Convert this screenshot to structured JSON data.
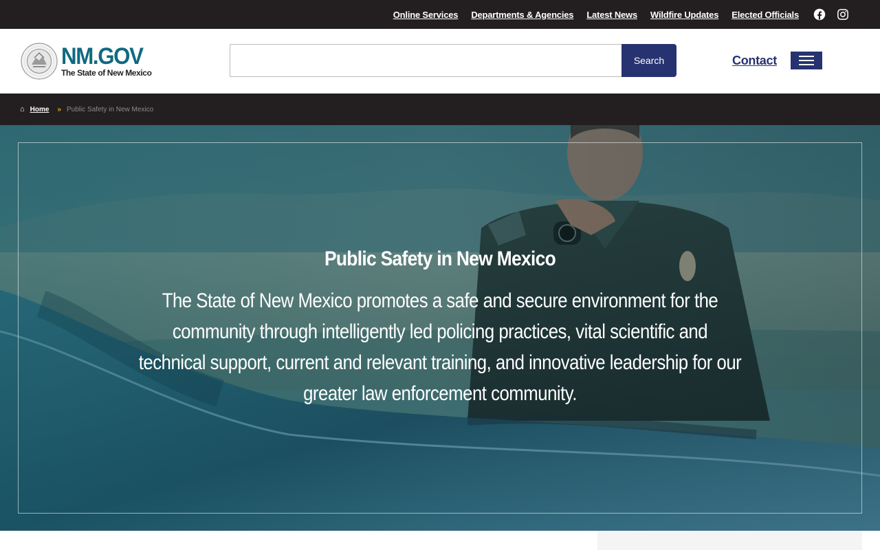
{
  "topbar": {
    "links": [
      {
        "label": "Online Services"
      },
      {
        "label": "Departments & Agencies"
      },
      {
        "label": "Latest News"
      },
      {
        "label": "Wildfire Updates"
      },
      {
        "label": "Elected Officials"
      }
    ],
    "social": [
      "facebook-icon",
      "instagram-icon"
    ]
  },
  "header": {
    "logo_title": "NM.GOV",
    "logo_subtitle": "The State of New Mexico",
    "search": {
      "value": "",
      "placeholder": "",
      "button_label": "Search"
    },
    "contact_label": "Contact"
  },
  "breadcrumb": {
    "home_label": "Home",
    "separator": "»",
    "current": "Public Safety in New Mexico"
  },
  "hero": {
    "title": "Public Safety in New Mexico",
    "text": "The State of New Mexico promotes a safe and secure environment for the community through intelligently led policing practices, vital scientific and technical support, current and relevant training, and innovative leadership for our greater law enforcement community."
  },
  "colors": {
    "topbar_bg": "#231f20",
    "brand_teal": "#0f6a80",
    "brand_navy": "#273270",
    "breadcrumb_separator": "#e2a52b"
  }
}
